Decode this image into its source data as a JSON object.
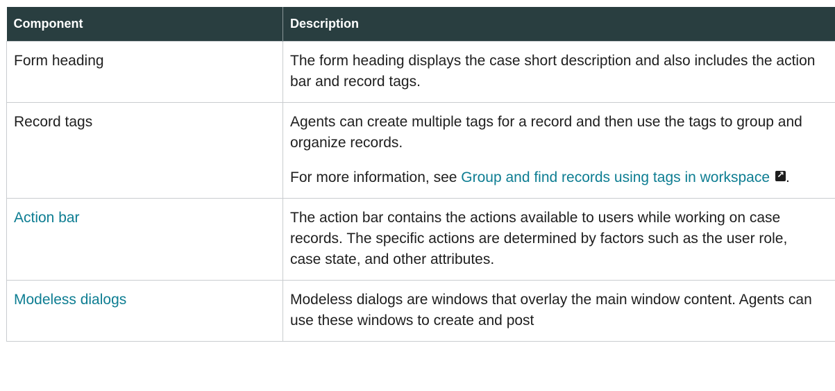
{
  "table": {
    "headers": [
      "Component",
      "Description"
    ],
    "rows": [
      {
        "component": "Form heading",
        "component_is_link": false,
        "description": [
          "The form heading displays the case short description and also includes the action bar and record tags."
        ]
      },
      {
        "component": "Record tags",
        "component_is_link": false,
        "description": [
          "Agents can create multiple tags for a record and then use the tags to group and organize records."
        ],
        "more_info": {
          "prefix": "For more information, see ",
          "link_text": "Group and find records using tags in workspace",
          "link_icon": "external-link-icon",
          "suffix": "."
        }
      },
      {
        "component": "Action bar",
        "component_is_link": true,
        "description": [
          "The action bar contains the actions available to users while working on case records. The specific actions are determined by factors such as the user role, case state, and other attributes."
        ]
      },
      {
        "component": "Modeless dialogs",
        "component_is_link": true,
        "description": [
          "Modeless dialogs are windows that overlay the main window content. Agents can use these windows to create and post"
        ]
      }
    ]
  },
  "colors": {
    "header_bg": "#293e40",
    "link": "#0d7d92",
    "border": "#c9cccf"
  }
}
